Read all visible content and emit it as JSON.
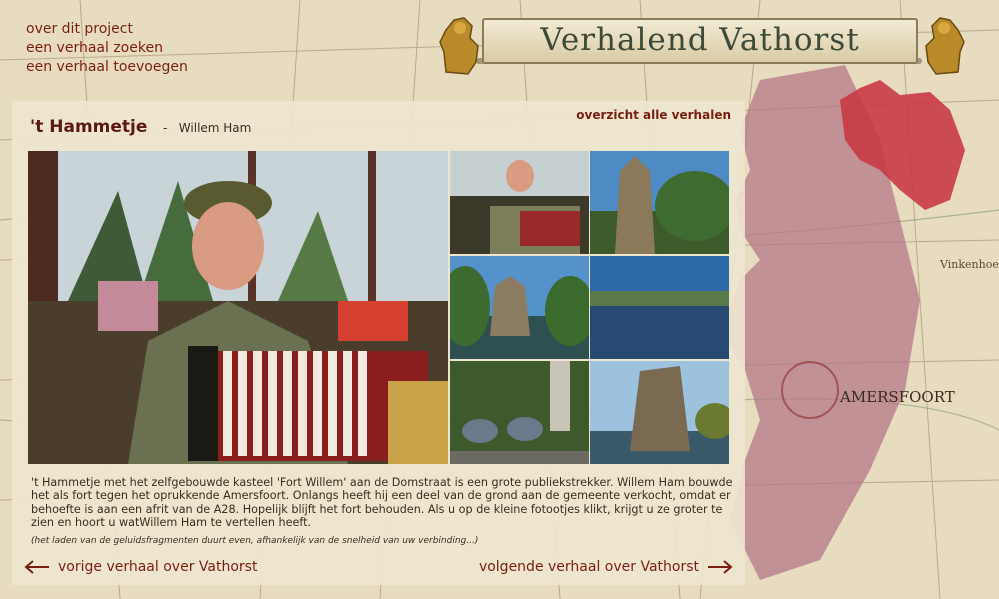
{
  "nav": {
    "items": [
      "over dit project",
      "een verhaal zoeken",
      "een verhaal toevoegen"
    ]
  },
  "brand": {
    "title": "Verhalend Vathorst"
  },
  "map": {
    "labels": [
      "Vinkenhoef",
      "AMERSFOORT"
    ],
    "highlight_color": "#c93a45",
    "region_color": "#b57888"
  },
  "story": {
    "title": "'t Hammetje",
    "separator": "-",
    "author": "Willem Ham",
    "overview_link": "overzicht alle verhalen",
    "caption": "'t Hammetje met het zelfgebouwde kasteel 'Fort Willem' aan de Domstraat is een grote publiekstrekker. Willem Ham bouwde het als fort tegen het oprukkende Amersfoort. Onlangs heeft hij een deel van de grond aan de gemeente verkocht, omdat er behoefte is aan een afrit van de A28. Hopelijk blijft het fort behouden. Als u op de kleine fotootjes klikt, krijgt u ze groter te zien en hoort u watWillem Ham te vertellen heeft.",
    "note": "(het laden van de geluidsfragmenten duurt even, afhankelijk van de snelheid van uw verbinding...)",
    "thumbnails": [
      "accordion-player-thumb",
      "castle-tower-thumb",
      "castle-lake-thumb",
      "lake-view-thumb",
      "peacocks-statue-thumb",
      "fort-ruin-thumb"
    ]
  },
  "pager": {
    "prev": "vorige verhaal over Vathorst",
    "next": "volgende verhaal over Vathorst"
  },
  "colors": {
    "accent": "#7a1e12",
    "panel": "#eee5d0"
  }
}
